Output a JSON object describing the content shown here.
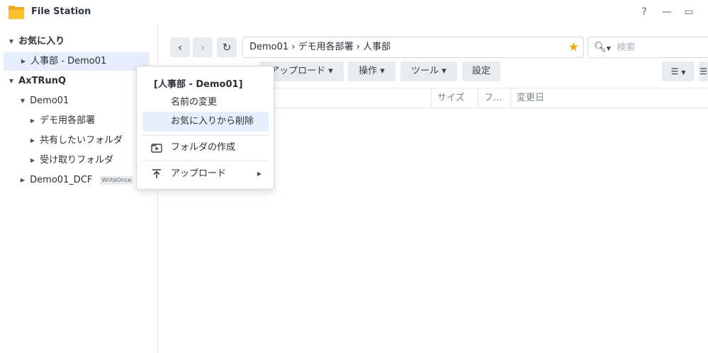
{
  "app": {
    "title": "File Station",
    "help_label": "?",
    "minimize_label": "—",
    "maximize_label": "▭"
  },
  "sidebar": {
    "favorites_label": "お気に入り",
    "favorite_items": [
      {
        "label": "人事部 - Demo01",
        "selected": true
      }
    ],
    "server_label": "AxTRunQ",
    "share_label": "Demo01",
    "share_children": [
      {
        "label": "デモ用各部署"
      },
      {
        "label": "共有したいフォルダ"
      },
      {
        "label": "受け取りフォルダ"
      }
    ],
    "share2_label": "Demo01_DCF",
    "share2_tag": "WriteOnce"
  },
  "toolbar": {
    "back_label": "‹",
    "forward_label": "›",
    "refresh_label": "↻",
    "path": "Demo01 › デモ用各部署 › 人事部",
    "search_placeholder": "検索",
    "upload_label": "アップロード ▾",
    "action_label": "操作 ▾",
    "tools_label": "ツール ▾",
    "settings_label": "設定"
  },
  "list": {
    "columns": [
      "サイズ",
      "フ...",
      "変更日"
    ]
  },
  "context_menu": {
    "title": "[人事部 - Demo01]",
    "items": [
      {
        "label": "名前の変更",
        "icon": "none",
        "highlighted": false
      },
      {
        "label": "お気に入りから削除",
        "icon": "none",
        "highlighted": true
      },
      {
        "label": "フォルダの作成",
        "icon": "folder-plus-icon",
        "highlighted": false
      },
      {
        "label": "アップロード",
        "icon": "upload-icon",
        "highlighted": false,
        "has_submenu": true
      }
    ]
  },
  "colors": {
    "accent": "#f0a800",
    "selection": "#e5eefa",
    "button_bg": "#e9ecef"
  }
}
